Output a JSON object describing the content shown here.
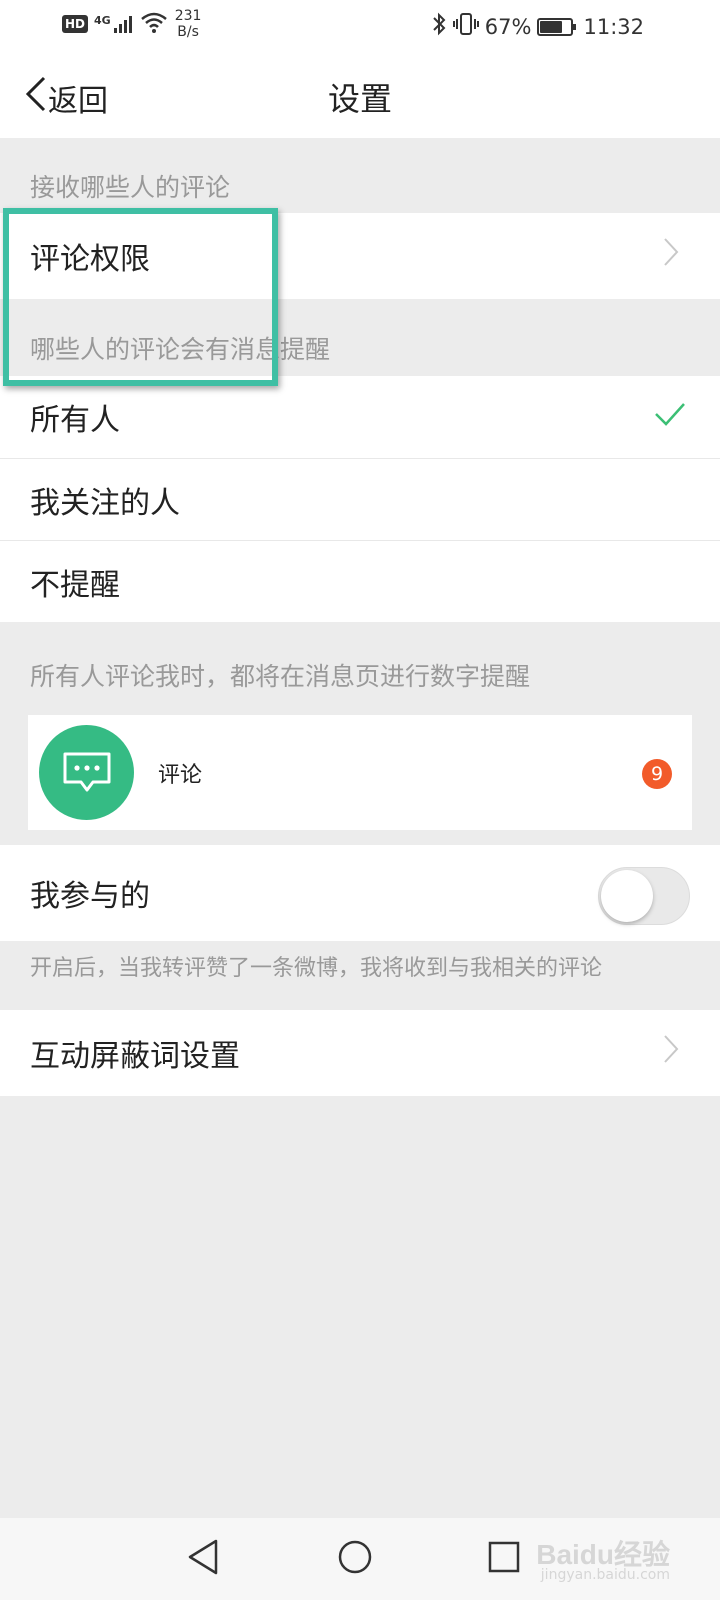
{
  "status_bar": {
    "hd_label": "HD",
    "network_label": "4G",
    "speed_value": "231",
    "speed_unit": "B/s",
    "battery_percent": "67%",
    "battery_level": 0.67,
    "time": "11:32"
  },
  "nav": {
    "back_label": "返回",
    "title": "设置"
  },
  "sections": {
    "receive_caption": "接收哪些人的评论",
    "comment_permission_label": "评论权限",
    "notify_caption": "哪些人的评论会有消息提醒",
    "notify_options": [
      "所有人",
      "我关注的人",
      "不提醒"
    ],
    "selected_option": "所有人",
    "preview_caption": "所有人评论我时，都将在消息页进行数字提醒",
    "preview_label": "评论",
    "preview_badge_count": "9",
    "participated_label": "我参与的",
    "participated_enabled": false,
    "participated_hint": "开启后，当我转评赞了一条微博，我将收到与我相关的评论",
    "block_words_label": "互动屏蔽词设置"
  },
  "watermark": {
    "logo_text": "Baidu经验",
    "url_text": "jingyan.baidu.com"
  },
  "colors": {
    "accent_green": "#35bb84",
    "check_green": "#3cbf75",
    "badge_red": "#f25b2a",
    "highlight_teal": "#3fbfa4"
  },
  "icons": {
    "back": "chevron-left-icon",
    "chevron": "chevron-right-icon",
    "check": "check-icon",
    "comment": "comment-bubble-icon",
    "sys_back": "triangle-back-icon",
    "sys_home": "circle-home-icon",
    "sys_recent": "square-recent-icon"
  }
}
